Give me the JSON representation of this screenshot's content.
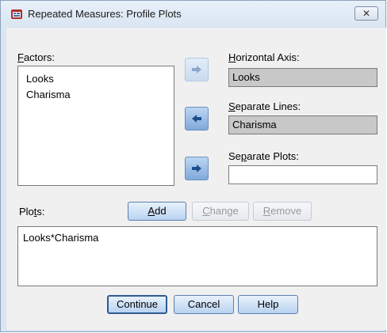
{
  "window": {
    "title": "Repeated Measures: Profile Plots",
    "close_label": "✕"
  },
  "factors": {
    "label": "Factors:",
    "label_key": "F",
    "label_rest": "actors:",
    "items": [
      "Looks",
      "Charisma"
    ]
  },
  "horizontal_axis": {
    "label_key": "H",
    "label_rest": "orizontal Axis:",
    "value": "Looks"
  },
  "separate_lines": {
    "label_key": "S",
    "label_rest": "eparate Lines:",
    "value": "Charisma"
  },
  "separate_plots": {
    "label_pre": "Se",
    "label_key": "p",
    "label_rest": "arate Plots:",
    "value": ""
  },
  "plots": {
    "label_pre": "Plo",
    "label_key": "t",
    "label_rest": "s:",
    "items": [
      "Looks*Charisma"
    ]
  },
  "buttons": {
    "add_key": "A",
    "add_rest": "dd",
    "change_key": "C",
    "change_rest": "hange",
    "remove_key": "R",
    "remove_rest": "emove",
    "continue": "Continue",
    "cancel": "Cancel",
    "help": "Help"
  },
  "colors": {
    "accent": "#2f5b8f",
    "button_face": "#b9d3f1",
    "disabled_text": "#9a9a9a"
  },
  "icons": {
    "arrow_right": "arrow-right-icon",
    "arrow_left": "arrow-left-icon",
    "app": "spss-dialog-icon"
  }
}
